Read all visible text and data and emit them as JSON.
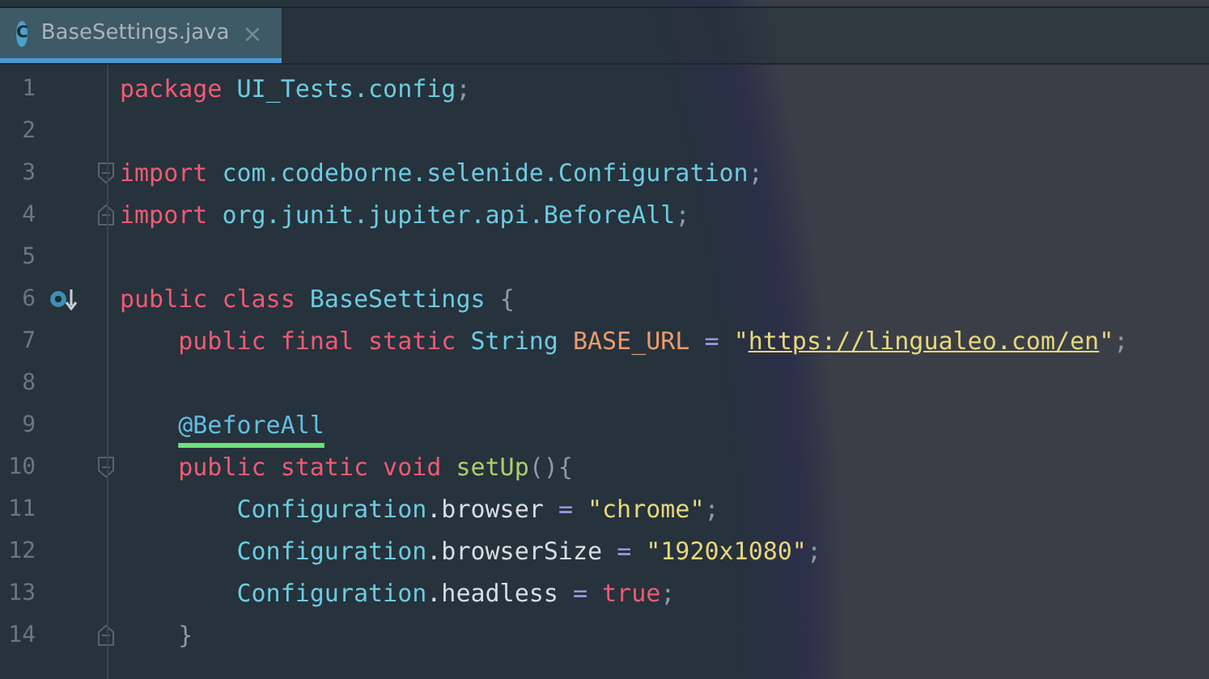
{
  "tabs": [
    {
      "label": "BaseSettings.java",
      "icon": "C",
      "close": "×",
      "selected": true
    }
  ],
  "lines": [
    {
      "number": "1",
      "tokens": [
        {
          "kind": "keyword",
          "text": "package "
        },
        {
          "kind": "type",
          "text": "UI_Tests.config"
        },
        {
          "kind": "punct",
          "text": ";"
        }
      ]
    },
    {
      "number": "2"
    },
    {
      "number": "3",
      "fold_open": true,
      "tokens": [
        {
          "kind": "keyword",
          "text": "import "
        },
        {
          "kind": "type",
          "text": "com.codeborne.selenide.Configuration"
        },
        {
          "kind": "punct",
          "text": ";"
        }
      ]
    },
    {
      "number": "4",
      "fold_close": true,
      "tokens": [
        {
          "kind": "keyword",
          "text": "import "
        },
        {
          "kind": "type",
          "text": "org.junit.jupiter.api.BeforeAll"
        },
        {
          "kind": "punct",
          "text": ";"
        }
      ]
    },
    {
      "number": "5"
    },
    {
      "number": "6",
      "implemented_marker": true,
      "tokens": [
        {
          "kind": "keyword",
          "text": "public class "
        },
        {
          "kind": "type",
          "text": "BaseSettings "
        },
        {
          "kind": "punct",
          "text": "{"
        }
      ]
    },
    {
      "number": "7",
      "tokens": [
        {
          "kind": "keyword",
          "text": "    public final static "
        },
        {
          "kind": "type",
          "text": "String "
        },
        {
          "kind": "constant",
          "text": "BASE_URL "
        },
        {
          "kind": "operator",
          "text": "= "
        },
        {
          "kind": "string",
          "text": "\""
        },
        {
          "kind": "url",
          "text": "https://lingualeo.com/en"
        },
        {
          "kind": "string",
          "text": "\""
        },
        {
          "kind": "punct",
          "text": ";"
        }
      ]
    },
    {
      "number": "8"
    },
    {
      "number": "9",
      "tokens": [
        {
          "kind": "annotation",
          "text": "    @BeforeAll",
          "underlined": true
        }
      ]
    },
    {
      "number": "10",
      "fold_open": true,
      "tokens": [
        {
          "kind": "keyword",
          "text": "    public static void "
        },
        {
          "kind": "method",
          "text": "setUp"
        },
        {
          "kind": "punct",
          "text": "(){"
        }
      ]
    },
    {
      "number": "11",
      "tokens": [
        {
          "kind": "type",
          "text": "        Configuration"
        },
        {
          "kind": "plain",
          "text": ".browser "
        },
        {
          "kind": "operator",
          "text": "= "
        },
        {
          "kind": "string",
          "text": "\"chrome\""
        },
        {
          "kind": "punct",
          "text": ";"
        }
      ]
    },
    {
      "number": "12",
      "tokens": [
        {
          "kind": "type",
          "text": "        Configuration"
        },
        {
          "kind": "plain",
          "text": ".browserSize "
        },
        {
          "kind": "operator",
          "text": "= "
        },
        {
          "kind": "string",
          "text": "\"1920x1080\""
        },
        {
          "kind": "punct",
          "text": ";"
        }
      ]
    },
    {
      "number": "13",
      "tokens": [
        {
          "kind": "type",
          "text": "        Configuration"
        },
        {
          "kind": "plain",
          "text": ".headless "
        },
        {
          "kind": "operator",
          "text": "= "
        },
        {
          "kind": "keyword",
          "text": "true"
        },
        {
          "kind": "punct",
          "text": ";"
        }
      ]
    },
    {
      "number": "14",
      "fold_close": true,
      "tokens": [
        {
          "kind": "punct",
          "text": "    }"
        }
      ]
    }
  ]
}
